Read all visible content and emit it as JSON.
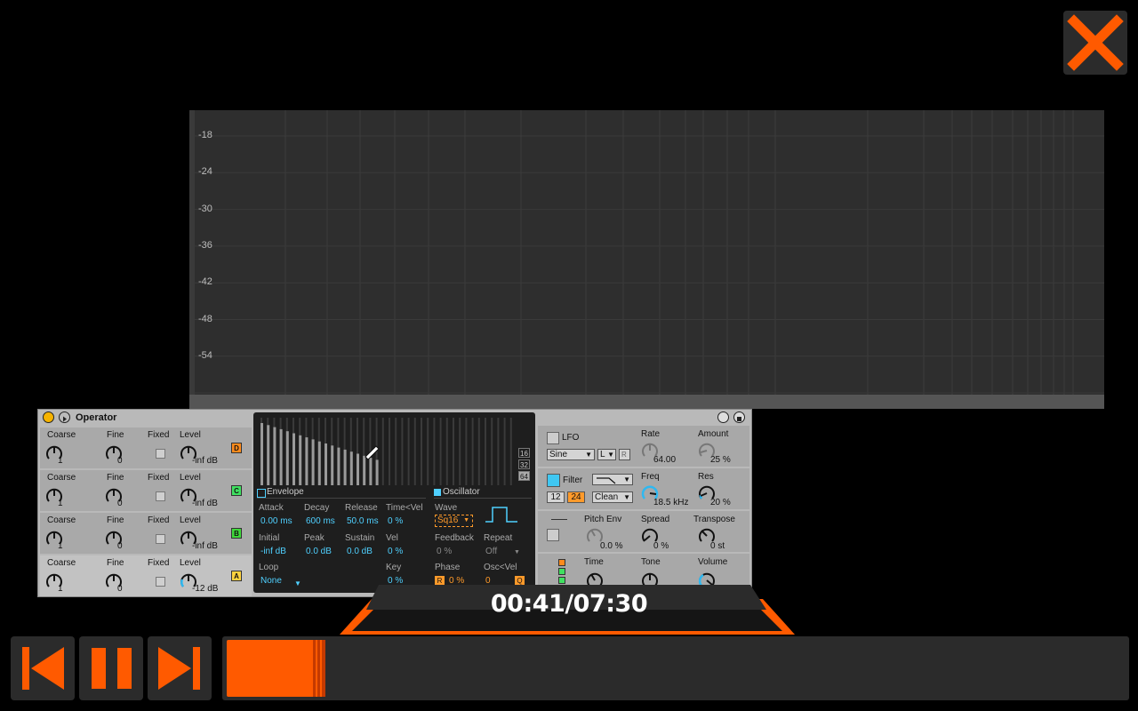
{
  "spectrum": {
    "db_labels": [
      "-18",
      "-24",
      "-30",
      "-36",
      "-42",
      "-48",
      "-54"
    ]
  },
  "operator": {
    "title": "Operator",
    "headers": {
      "coarse": "Coarse",
      "fine": "Fine",
      "fixed": "Fixed",
      "level": "Level"
    },
    "rows": [
      {
        "coarse": "1",
        "fine": "0",
        "level": "-inf dB",
        "osc": "D",
        "osc_color": "#ff8a1c"
      },
      {
        "coarse": "1",
        "fine": "0",
        "level": "-inf dB",
        "osc": "C",
        "osc_color": "#3fe060"
      },
      {
        "coarse": "1",
        "fine": "0",
        "level": "-inf dB",
        "osc": "B",
        "osc_color": "#3fd83a"
      },
      {
        "coarse": "1",
        "fine": "0",
        "level": "-12 dB",
        "osc": "A",
        "osc_color": "#ffd23f"
      }
    ],
    "partials_buttons": [
      "16",
      "32",
      "64"
    ],
    "envelope": {
      "section": "Envelope",
      "attack_label": "Attack",
      "attack": "0.00 ms",
      "decay_label": "Decay",
      "decay": "600 ms",
      "release_label": "Release",
      "release": "50.0 ms",
      "timevel_label": "Time<Vel",
      "timevel": "0 %",
      "initial_label": "Initial",
      "initial": "-inf dB",
      "peak_label": "Peak",
      "peak": "0.0 dB",
      "sustain_label": "Sustain",
      "sustain": "0.0 dB",
      "vel_label": "Vel",
      "vel": "0 %",
      "loop_label": "Loop",
      "loop": "None",
      "key_label": "Key",
      "key": "0 %"
    },
    "oscillator": {
      "section": "Oscillator",
      "wave_label": "Wave",
      "wave": "Sq16",
      "feedback_label": "Feedback",
      "feedback": "0 %",
      "repeat_label": "Repeat",
      "repeat": "Off",
      "phase_label": "Phase",
      "phase_r": "R",
      "phase": "0 %",
      "oscvel_label": "Osc<Vel",
      "oscvel": "0",
      "oscvel_q": "Q"
    },
    "lfo": {
      "label": "LFO",
      "wave": "Sine",
      "dest": "L",
      "r": "R",
      "rate_label": "Rate",
      "rate": "64.00",
      "amount_label": "Amount",
      "amount": "25 %"
    },
    "filter": {
      "label": "Filter",
      "slope_12": "12",
      "slope_24": "24",
      "mode": "Clean",
      "freq_label": "Freq",
      "freq": "18.5 kHz",
      "res_label": "Res",
      "res": "20 %"
    },
    "pitch": {
      "pitch_env_label": "Pitch Env",
      "pitch_env": "0.0 %",
      "spread_label": "Spread",
      "spread": "0 %",
      "transpose_label": "Transpose",
      "transpose": "0 st"
    },
    "global": {
      "time_label": "Time",
      "tone_label": "Tone",
      "volume_label": "Volume"
    }
  },
  "player": {
    "time": "00:41/07:30",
    "progress": 0.11,
    "accent": "#ff5a00"
  }
}
